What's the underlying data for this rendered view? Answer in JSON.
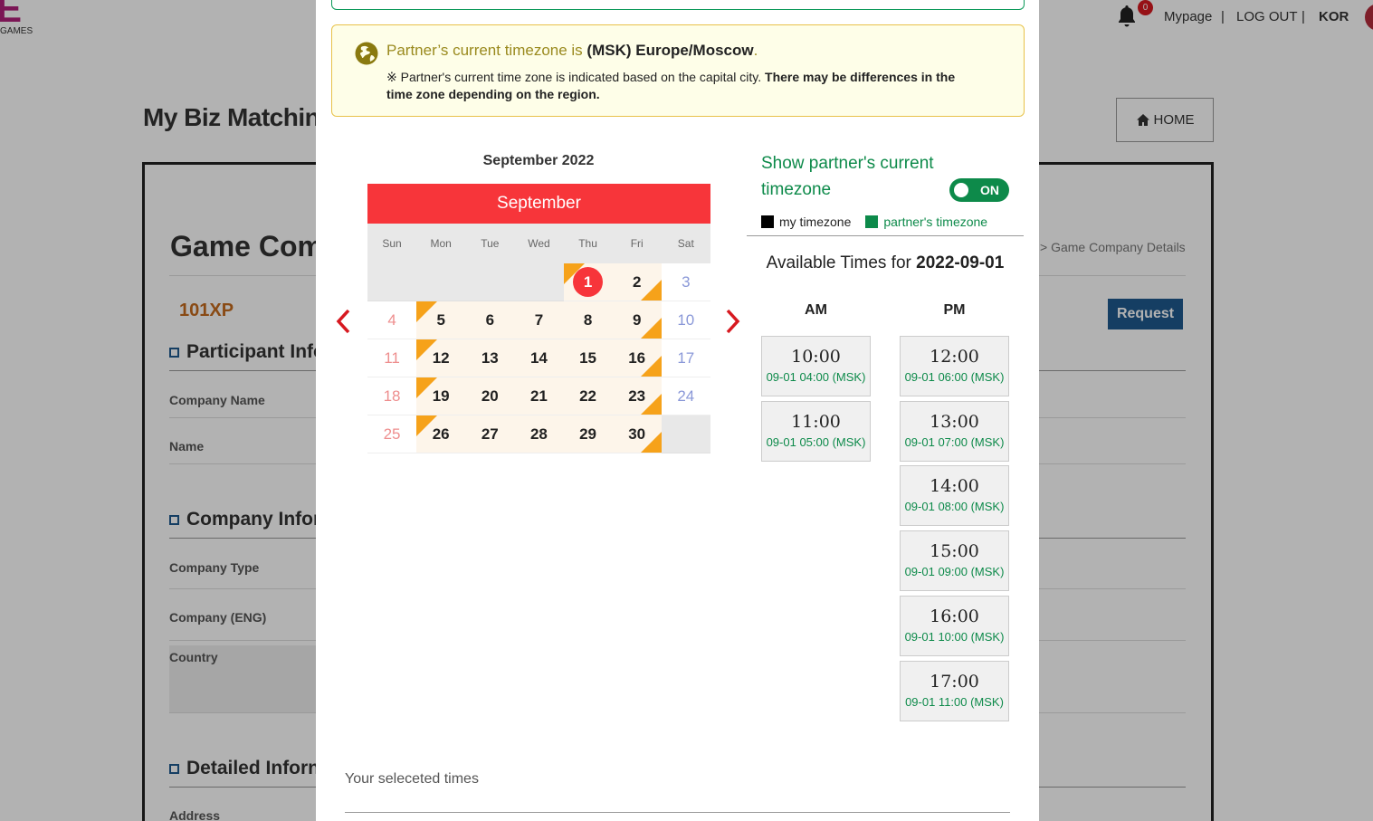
{
  "background": {
    "logo": {
      "letters": "E",
      "sub": "GAMES"
    },
    "notifications": {
      "count": "0"
    },
    "nav": {
      "mypage": "Mypage",
      "sep": "|",
      "logout": "LOG OUT",
      "lang": "KOR"
    },
    "page_title": "My Biz Matchin",
    "home_button": "HOME",
    "section_title": "Game Com",
    "breadcrumb": "> Game Company Details",
    "company_short": "101XP",
    "request_button": "Request",
    "participant_header": "Participant Info",
    "fields_participant": [
      "Company Name",
      "Name"
    ],
    "company_header": "Company Infor",
    "fields_company": [
      "Company Type",
      "Company (ENG)",
      "Country"
    ],
    "detail_header": "Detailed Inforn",
    "fields_detail": [
      "Address"
    ]
  },
  "timezone_notice": {
    "prefix": "Partner’s current timezone is ",
    "zone": "(MSK) Europe/Moscow",
    "suffix": ".",
    "note": "※ Partner's current time zone is indicated based on the capital city. ",
    "note_bold": "There may be differences in the time zone depending on the region."
  },
  "calendar": {
    "title": "September 2022",
    "month_label": "September",
    "weekdays": [
      "Sun",
      "Mon",
      "Tue",
      "Wed",
      "Thu",
      "Fri",
      "Sat"
    ],
    "prev_icon": "chevron-left",
    "next_icon": "chevron-right",
    "selected_date": "1",
    "weeks": [
      [
        null,
        null,
        null,
        null,
        "1",
        "2",
        "3"
      ],
      [
        "4",
        "5",
        "6",
        "7",
        "8",
        "9",
        "10"
      ],
      [
        "11",
        "12",
        "13",
        "14",
        "15",
        "16",
        "17"
      ],
      [
        "18",
        "19",
        "20",
        "21",
        "22",
        "23",
        "24"
      ],
      [
        "25",
        "26",
        "27",
        "28",
        "29",
        "30",
        null
      ]
    ],
    "marker_tl": [
      "1",
      "5",
      "12",
      "19",
      "26"
    ],
    "marker_br": [
      "2",
      "9",
      "16",
      "23",
      "30"
    ]
  },
  "toggle": {
    "label": "Show partner's current timezone",
    "state": "ON"
  },
  "legend": {
    "mine": "my timezone",
    "partner": "partner's timezone",
    "mine_color": "#000000",
    "partner_color": "#0d8a4a"
  },
  "available": {
    "prefix": "Available Times for ",
    "date": "2022-09-01"
  },
  "am_header": "AM",
  "pm_header": "PM",
  "am_slots": [
    {
      "time": "10:00",
      "partner": "09-01 04:00 (MSK)"
    },
    {
      "time": "11:00",
      "partner": "09-01 05:00 (MSK)"
    }
  ],
  "pm_slots": [
    {
      "time": "12:00",
      "partner": "09-01 06:00 (MSK)"
    },
    {
      "time": "13:00",
      "partner": "09-01 07:00 (MSK)"
    },
    {
      "time": "14:00",
      "partner": "09-01 08:00 (MSK)"
    },
    {
      "time": "15:00",
      "partner": "09-01 09:00 (MSK)"
    },
    {
      "time": "16:00",
      "partner": "09-01 10:00 (MSK)"
    },
    {
      "time": "17:00",
      "partner": "09-01 11:00 (MSK)"
    }
  ],
  "selected_times_label": "Your seleceted times",
  "colors": {
    "accent_red": "#f7353a",
    "green": "#0d8a4a",
    "marker": "#f6a21a",
    "navy": "#1f5a8f"
  }
}
